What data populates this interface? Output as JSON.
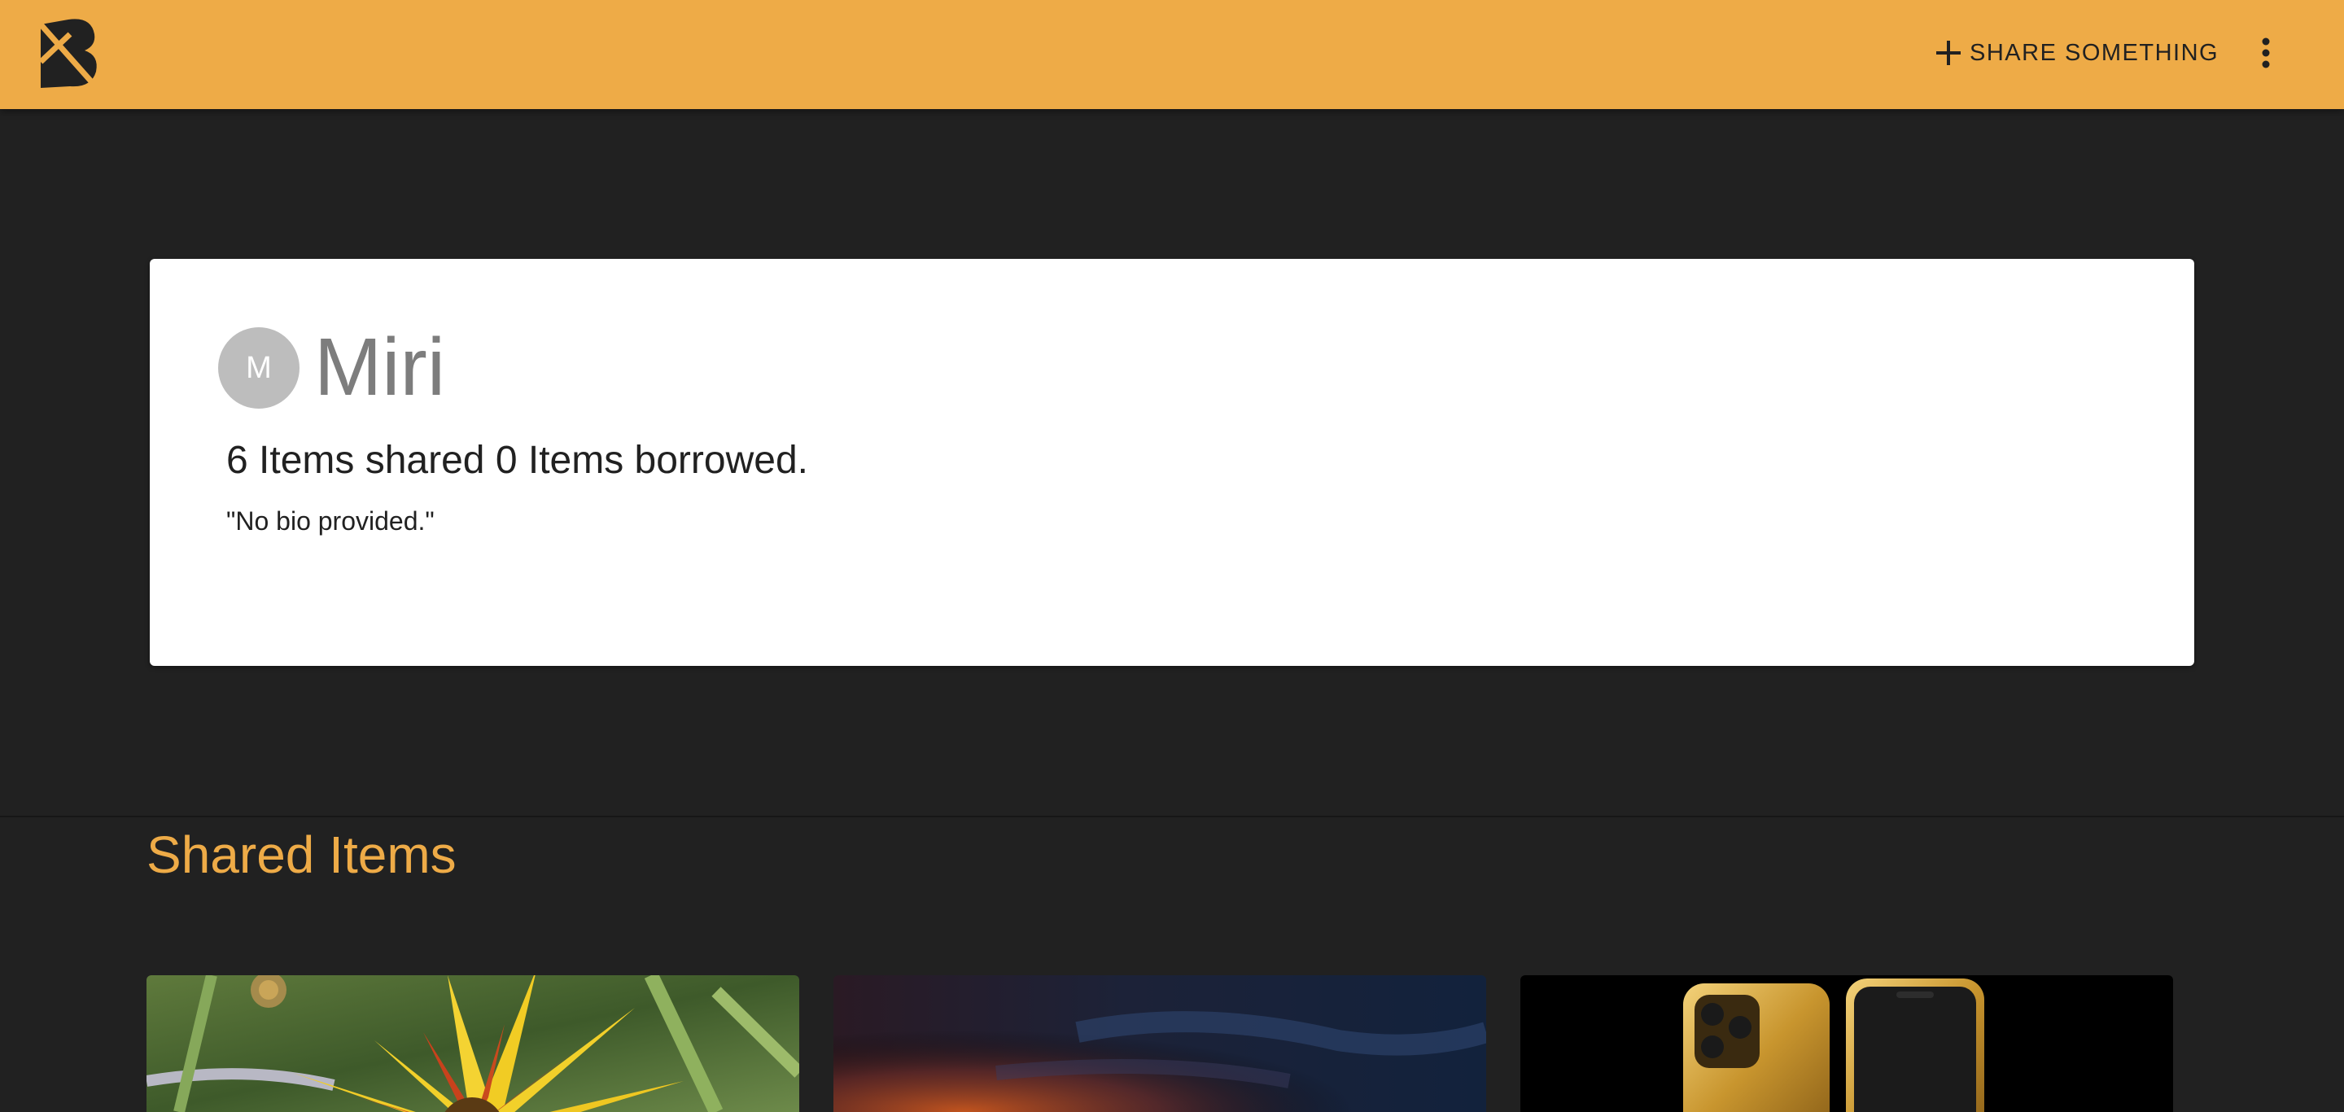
{
  "header": {
    "logo_icon": "boomtown-logo-icon",
    "share_icon": "plus-icon",
    "share_label": "SHARE SOMETHING",
    "more_icon": "more-vert-icon",
    "bar_color": "#eeab47"
  },
  "profile": {
    "avatar_initial": "M",
    "name": "Miri",
    "stats": "6 Items shared 0 Items borrowed.",
    "bio": "\"No bio provided.\""
  },
  "shared_items": {
    "title": "Shared Items",
    "items": [
      {
        "image_icon": "flower-photo"
      },
      {
        "image_icon": "sunset-sky-photo"
      },
      {
        "image_icon": "gold-phone-photo"
      }
    ]
  },
  "colors": {
    "accent": "#eeab47",
    "background": "#212121",
    "card": "#ffffff"
  }
}
